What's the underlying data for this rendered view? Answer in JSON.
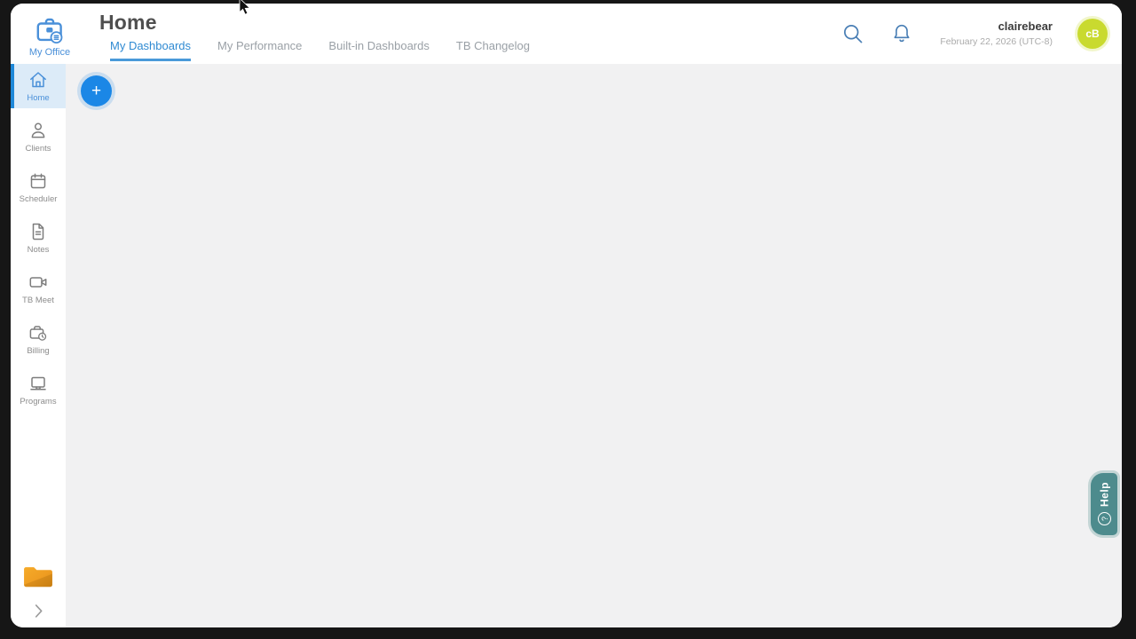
{
  "logo": {
    "label": "My Office",
    "icon": "briefcase-icon"
  },
  "header": {
    "title": "Home",
    "tabs": [
      {
        "label": "My Dashboards",
        "active": true
      },
      {
        "label": "My Performance",
        "active": false
      },
      {
        "label": "Built-in Dashboards",
        "active": false
      },
      {
        "label": "TB Changelog",
        "active": false
      }
    ],
    "icons": [
      "search-icon",
      "bell-icon"
    ],
    "user": {
      "name": "clairebear",
      "datetime": "February 22, 2026 (UTC-8)",
      "avatar_initials": "cB"
    }
  },
  "sidebar": {
    "items": [
      {
        "label": "Home",
        "icon": "home-icon",
        "active": true
      },
      {
        "label": "Clients",
        "icon": "clients-icon",
        "active": false
      },
      {
        "label": "Scheduler",
        "icon": "calendar-icon",
        "active": false
      },
      {
        "label": "Notes",
        "icon": "document-icon",
        "active": false
      },
      {
        "label": "TB Meet",
        "icon": "video-camera-icon",
        "active": false
      },
      {
        "label": "Billing",
        "icon": "briefcase-clock-icon",
        "active": false
      },
      {
        "label": "Programs",
        "icon": "laptop-icon",
        "active": false
      }
    ],
    "footer_icons": [
      "folder-icon",
      "chevron-right-icon"
    ]
  },
  "content": {
    "add_button_label": "+"
  },
  "help": {
    "label": "Help",
    "icon_glyph": "?"
  },
  "colors": {
    "accent_blue": "#1e88d8",
    "active_item_bg": "#dcebf8",
    "tab_active": "#2f8ad2",
    "avatar_lime": "#c9da2f",
    "folder_orange": "#f0a02c",
    "help_teal": "#4d8b8d",
    "content_bg": "#f1f1f2",
    "frame_black": "#161616"
  }
}
